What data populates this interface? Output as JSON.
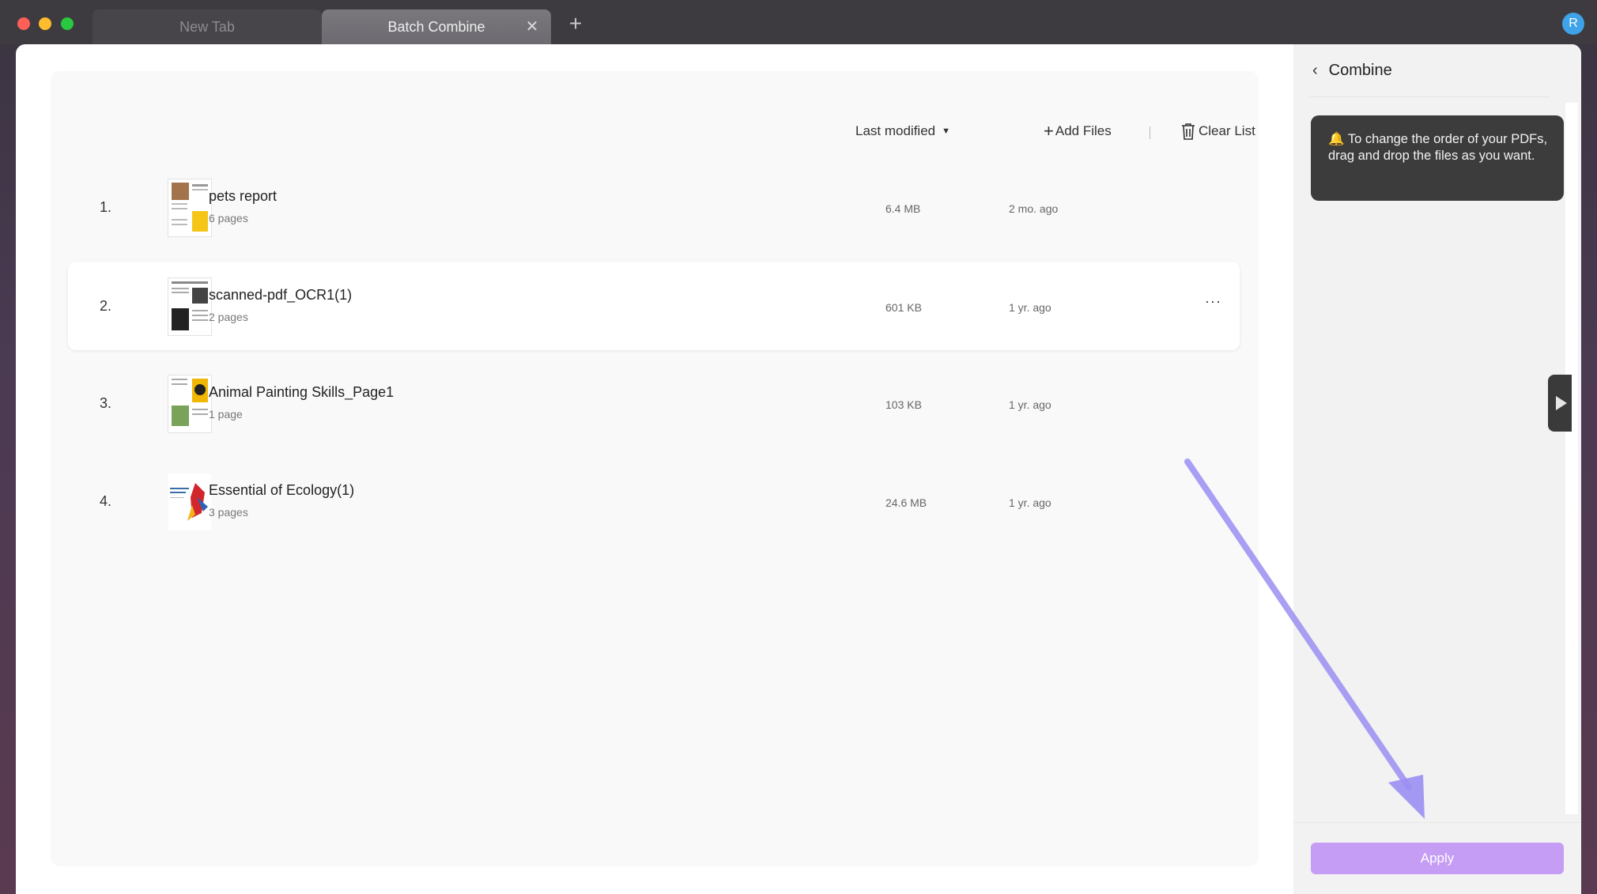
{
  "titlebar": {
    "tabs": [
      {
        "label": "New Tab"
      },
      {
        "label": "Batch Combine"
      }
    ],
    "close_glyph": "✕",
    "new_tab_glyph": "+",
    "avatar_letter": "R"
  },
  "toolbar": {
    "sort_label": "Last modified",
    "add_files_label": "Add Files",
    "clear_list_label": "Clear List"
  },
  "files": [
    {
      "index": "1.",
      "name": "pets report",
      "pages": "6 pages",
      "size": "6.4 MB",
      "modified": "2 mo. ago"
    },
    {
      "index": "2.",
      "name": "scanned-pdf_OCR1(1)",
      "pages": "2 pages",
      "size": "601 KB",
      "modified": "1 yr. ago"
    },
    {
      "index": "3.",
      "name": "Animal Painting Skills_Page1",
      "pages": "1 page",
      "size": "103 KB",
      "modified": "1 yr. ago"
    },
    {
      "index": "4.",
      "name": "Essential of Ecology(1)",
      "pages": "3 pages",
      "size": "24.6 MB",
      "modified": "1 yr. ago"
    }
  ],
  "more_glyph": "···",
  "side_panel": {
    "title": "Combine",
    "tip": "🔔 To change the order of your PDFs, drag and drop the files as you want.",
    "apply_label": "Apply"
  },
  "colors": {
    "apply_button": "#c59df5",
    "annotation_arrow": "#9b8ff2",
    "avatar": "#3ea3e8"
  }
}
